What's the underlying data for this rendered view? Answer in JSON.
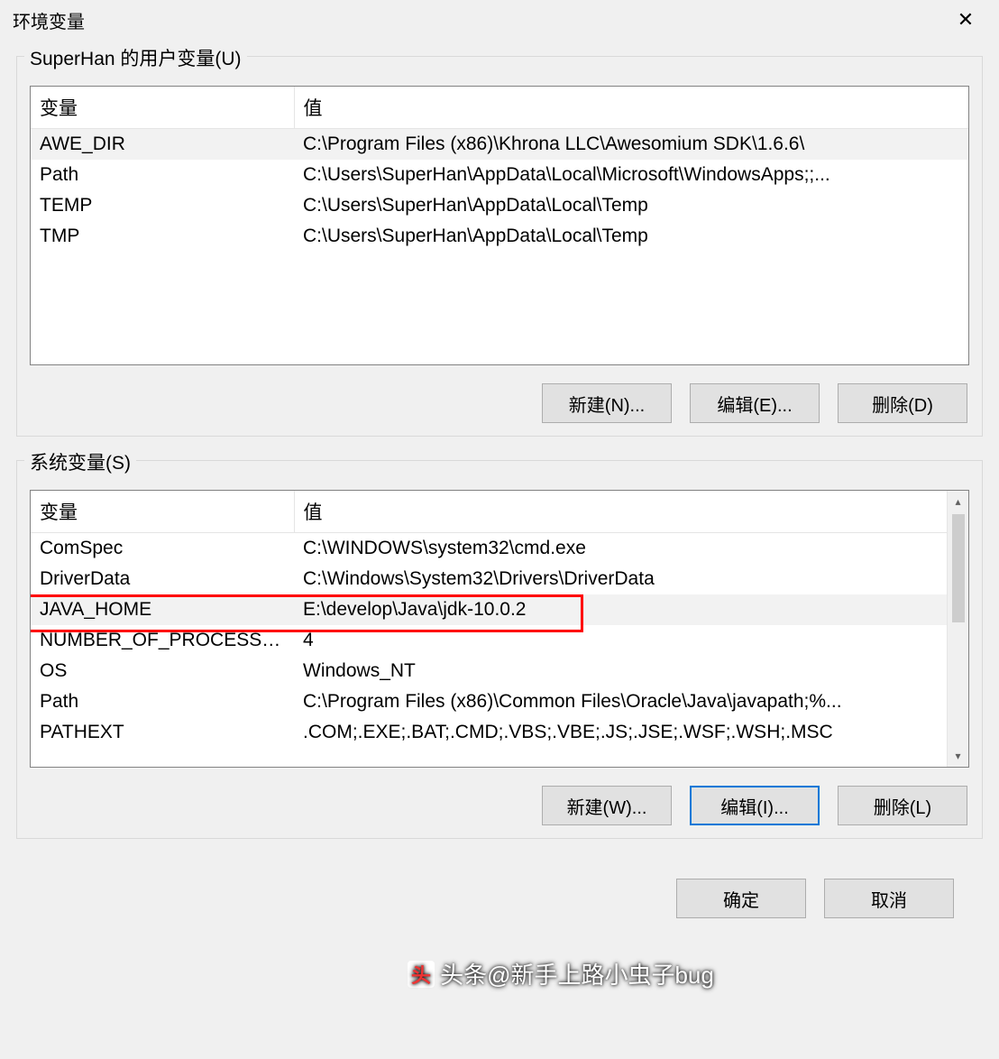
{
  "window": {
    "title": "环境变量"
  },
  "userVars": {
    "legend": "SuperHan 的用户变量(U)",
    "columns": {
      "name": "变量",
      "value": "值"
    },
    "rows": [
      {
        "name": "AWE_DIR",
        "value": "C:\\Program Files (x86)\\Khrona LLC\\Awesomium SDK\\1.6.6\\",
        "selected": true
      },
      {
        "name": "Path",
        "value": "C:\\Users\\SuperHan\\AppData\\Local\\Microsoft\\WindowsApps;;..."
      },
      {
        "name": "TEMP",
        "value": "C:\\Users\\SuperHan\\AppData\\Local\\Temp"
      },
      {
        "name": "TMP",
        "value": "C:\\Users\\SuperHan\\AppData\\Local\\Temp"
      }
    ],
    "buttons": {
      "new": "新建(N)...",
      "edit": "编辑(E)...",
      "del": "删除(D)"
    }
  },
  "sysVars": {
    "legend": "系统变量(S)",
    "columns": {
      "name": "变量",
      "value": "值"
    },
    "rows": [
      {
        "name": "ComSpec",
        "value": "C:\\WINDOWS\\system32\\cmd.exe"
      },
      {
        "name": "DriverData",
        "value": "C:\\Windows\\System32\\Drivers\\DriverData"
      },
      {
        "name": "JAVA_HOME",
        "value": "E:\\develop\\Java\\jdk-10.0.2",
        "selected": true,
        "highlighted": true
      },
      {
        "name": "NUMBER_OF_PROCESSORS",
        "value": "4"
      },
      {
        "name": "OS",
        "value": "Windows_NT"
      },
      {
        "name": "Path",
        "value": "C:\\Program Files (x86)\\Common Files\\Oracle\\Java\\javapath;%..."
      },
      {
        "name": "PATHEXT",
        "value": ".COM;.EXE;.BAT;.CMD;.VBS;.VBE;.JS;.JSE;.WSF;.WSH;.MSC"
      }
    ],
    "buttons": {
      "new": "新建(W)...",
      "edit": "编辑(I)...",
      "del": "删除(L)"
    }
  },
  "dialogButtons": {
    "ok": "确定",
    "cancel": "取消"
  },
  "watermark": "头条@新手上路小虫子bug"
}
